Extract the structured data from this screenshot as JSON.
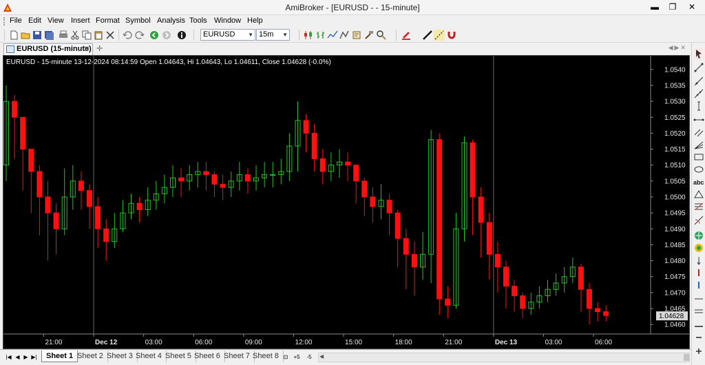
{
  "window": {
    "title": "AmiBroker - [EURUSD -  - 15-minute]",
    "minimize_glyph": "▬",
    "restore_glyph": "❐",
    "close_glyph": "✕"
  },
  "menu": [
    "File",
    "Edit",
    "View",
    "Insert",
    "Format",
    "Symbol",
    "Analysis",
    "Tools",
    "Window",
    "Help"
  ],
  "toolbar": {
    "symbol_value": "EURUSD",
    "interval_value": "15m"
  },
  "document_tab": {
    "label": "EURUSD (15-minute)",
    "close_glyph": "✕",
    "new_tab_glyph": "✛"
  },
  "chart_header": "EURUSD - 15-minute 13-12-2024 08:14:59 Open 1.04643, Hi 1.04643, Lo 1.04611, Close 1.04628 (-0.0%)",
  "chart_data": {
    "type": "candlestick",
    "up_color": "#22c322",
    "down_color": "#ff1010",
    "ylim": [
      1.0457,
      1.0543
    ],
    "y_ticks": [
      "1.0540",
      "1.0535",
      "1.0530",
      "1.0525",
      "1.0520",
      "1.0515",
      "1.0510",
      "1.0505",
      "1.0500",
      "1.0495",
      "1.0490",
      "1.0485",
      "1.0480",
      "1.0475",
      "1.0470",
      "1.0465",
      "1.0460"
    ],
    "x_ticks": [
      {
        "label": "21:00",
        "bar": 5
      },
      {
        "label": "Dec 12",
        "bar": 11
      },
      {
        "label": "03:00",
        "bar": 17
      },
      {
        "label": "06:00",
        "bar": 23
      },
      {
        "label": "09:00",
        "bar": 29
      },
      {
        "label": "12:00",
        "bar": 35
      },
      {
        "label": "15:00",
        "bar": 41
      },
      {
        "label": "18:00",
        "bar": 47
      },
      {
        "label": "21:00",
        "bar": 53
      },
      {
        "label": "Dec 13",
        "bar": 59
      },
      {
        "label": "03:00",
        "bar": 65
      },
      {
        "label": "06:00",
        "bar": 71
      }
    ],
    "day_separators": [
      11,
      59
    ],
    "last_price_label": "1.04628",
    "last_price": 1.04628,
    "close": [
      1.053,
      1.0525,
      1.0515,
      1.0508,
      1.05,
      1.0495,
      1.049,
      1.05,
      1.0505,
      1.0502,
      1.0497,
      1.049,
      1.0486,
      1.049,
      1.0495,
      1.0498,
      1.0496,
      1.0499,
      1.0501,
      1.0503,
      1.0506,
      1.0505,
      1.0507,
      1.0508,
      1.0507,
      1.0504,
      1.0503,
      1.0505,
      1.0507,
      1.0505,
      1.0506,
      1.0507,
      1.0507,
      1.0508,
      1.0516,
      1.0524,
      1.052,
      1.0512,
      1.0508,
      1.051,
      1.0511,
      1.051,
      1.0505,
      1.05,
      1.0497,
      1.0499,
      1.0495,
      1.0487,
      1.0482,
      1.0478,
      1.0482,
      1.0518,
      1.0468,
      1.0466,
      1.049,
      1.0517,
      1.05,
      1.0492,
      1.0482,
      1.0478,
      1.0472,
      1.0469,
      1.0465,
      1.0467,
      1.0469,
      1.0471,
      1.0473,
      1.0475,
      1.0478,
      1.0471,
      1.0465,
      1.0464,
      1.04628
    ],
    "high": [
      1.0535,
      1.0532,
      1.0522,
      1.0515,
      1.051,
      1.0505,
      1.0498,
      1.0509,
      1.051,
      1.0508,
      1.0504,
      1.05,
      1.0493,
      1.0495,
      1.0499,
      1.0501,
      1.05,
      1.0503,
      1.0505,
      1.0507,
      1.051,
      1.0509,
      1.051,
      1.0511,
      1.0511,
      1.0508,
      1.0507,
      1.0508,
      1.0511,
      1.0509,
      1.051,
      1.0511,
      1.0511,
      1.0512,
      1.052,
      1.053,
      1.0526,
      1.0523,
      1.0515,
      1.0514,
      1.0515,
      1.0514,
      1.051,
      1.0506,
      1.0503,
      1.0504,
      1.0501,
      1.0496,
      1.049,
      1.0486,
      1.0489,
      1.0521,
      1.052,
      1.0472,
      1.0495,
      1.0519,
      1.0518,
      1.0503,
      1.0495,
      1.0486,
      1.048,
      1.0474,
      1.047,
      1.047,
      1.0472,
      1.0474,
      1.0476,
      1.0478,
      1.0481,
      1.0479,
      1.0473,
      1.0467,
      1.0466
    ],
    "low": [
      1.0505,
      1.0512,
      1.0502,
      1.0495,
      1.0488,
      1.048,
      1.0482,
      1.0488,
      1.0496,
      1.0496,
      1.049,
      1.0484,
      1.048,
      1.0484,
      1.0489,
      1.0493,
      1.0492,
      1.0494,
      1.0496,
      1.0498,
      1.05,
      1.05,
      1.0502,
      1.0503,
      1.0502,
      1.05,
      1.0499,
      1.05,
      1.0502,
      1.0501,
      1.0502,
      1.0503,
      1.0503,
      1.0504,
      1.0505,
      1.0508,
      1.0514,
      1.0508,
      1.0504,
      1.0505,
      1.0506,
      1.0505,
      1.0498,
      1.0494,
      1.0492,
      1.0493,
      1.0488,
      1.0478,
      1.0471,
      1.0469,
      1.0474,
      1.0473,
      1.0463,
      1.0462,
      1.0465,
      1.0486,
      1.0488,
      1.0481,
      1.0474,
      1.047,
      1.0465,
      1.0464,
      1.0462,
      1.0463,
      1.0465,
      1.0467,
      1.0469,
      1.047,
      1.0473,
      1.0464,
      1.046,
      1.0461,
      1.0461
    ]
  },
  "sheets": [
    "Sheet 1",
    "Sheet 2",
    "Sheet 3",
    "Sheet 4",
    "Sheet 5",
    "Sheet 6",
    "Sheet 7",
    "Sheet 8"
  ],
  "active_sheet": "Sheet 1",
  "sheet_extra": {
    "lock_glyph": "🔒",
    "minus_sheet": "+5",
    "plus_sheet": "-5"
  }
}
